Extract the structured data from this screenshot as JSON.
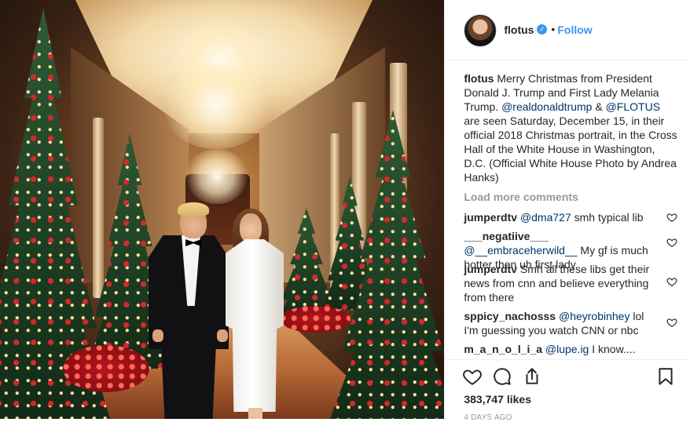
{
  "post": {
    "account": {
      "username": "flotus",
      "follow_label": "Follow",
      "separator": "•",
      "verified_mark": "✓",
      "icons": [
        "avatar",
        "verified-badge-icon"
      ]
    },
    "caption": {
      "user": "flotus",
      "text_1": " Merry Christmas from President Donald J. Trump and First Lady Melania Trump. ",
      "mention_1": "@realdonaldtrump",
      "text_2": " & ",
      "mention_2": "@FLOTUS",
      "text_3": " are seen Saturday, December 15, in their official 2018 Christmas portrait, in the Cross Hall of the White House in Washington, D.C. (Official White House Photo by Andrea Hanks)"
    },
    "load_more_label": "Load more comments",
    "comments": [
      {
        "user": "jumperdtv",
        "mention": "@dma727",
        "text": " smh typical lib"
      },
      {
        "user": "___negatiive___",
        "mention": "@__embraceherwild__",
        "text": " My gf is much hotter then uh first lady"
      },
      {
        "user": "jumperdtv",
        "mention": "",
        "text": " Smh all these libs get their news from cnn and believe everything from there"
      },
      {
        "user": "sppicy_nachosss",
        "mention": "@heyrobinhey",
        "text": " lol I'm guessing you watch CNN or nbc"
      },
      {
        "user": "m_a_n_o_l_i_a",
        "mention": "@lupe.ig",
        "text": " I know...."
      }
    ],
    "likes_label": "383,747 likes",
    "timestamp": "4 DAYS AGO",
    "action_icons": [
      "heart-icon",
      "comment-icon",
      "share-icon",
      "bookmark-icon"
    ],
    "colors": {
      "link_blue": "#3897f0",
      "mention_blue": "#003569",
      "muted_gray": "#999999",
      "text": "#262626"
    }
  }
}
